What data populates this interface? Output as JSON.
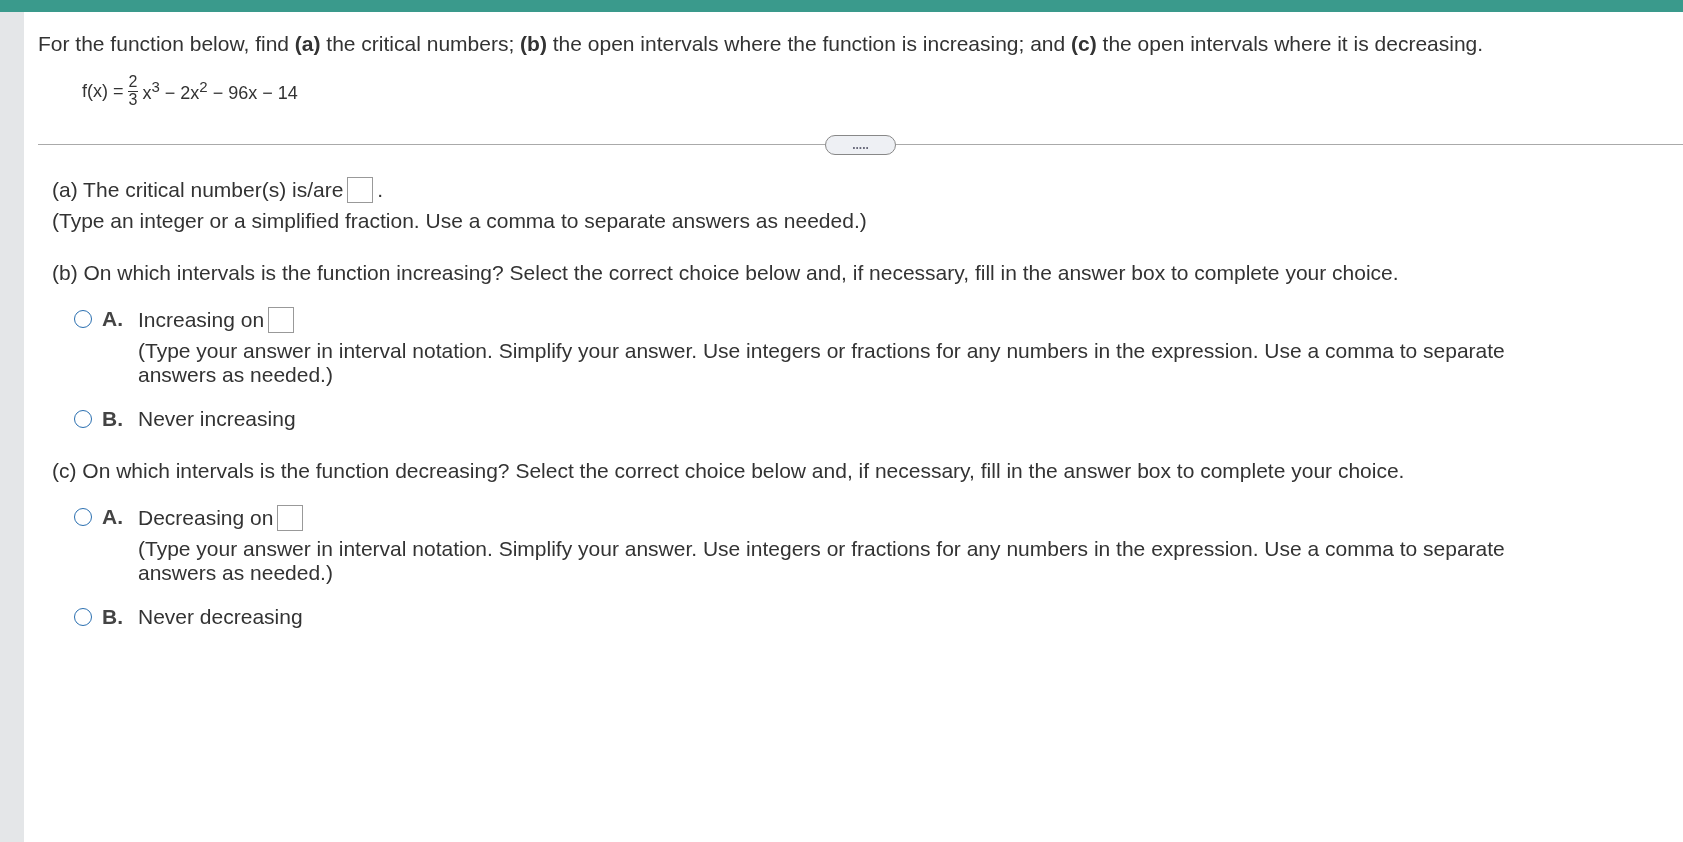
{
  "question": "For the function below, find **(a)** the critical numbers; **(b)** the open intervals where the function is increasing; and **(c)** the open intervals where it is decreasing.",
  "function": {
    "lhs": "f(x) =",
    "numerator": "2",
    "denominator": "3",
    "rest": "x$^{3}$ − 2x$^{2}$ − 96x − 14"
  },
  "expand_button": ".....",
  "part_a": {
    "prompt": "(a) The critical number(s) is/are",
    "after": ".",
    "hint": "(Type an integer or a simplified fraction. Use a comma to separate answers as needed.)"
  },
  "part_b": {
    "prompt": "(b) On which intervals is the function increasing? Select the correct choice below and, if necessary, fill in the answer box to complete your choice.",
    "choices": [
      {
        "kind": "answer",
        "letter": "A.",
        "label": "Increasing on",
        "hint": "(Type your answer in interval notation. Simplify your answer. Use integers or fractions for any numbers in the expression. Use a comma to separate answers as needed.)",
        "selected": false
      },
      {
        "kind": "plain",
        "letter": "B.",
        "label": "Never increasing",
        "selected": false
      }
    ]
  },
  "part_c": {
    "prompt": "(c) On which intervals is the function decreasing? Select the correct choice below and, if necessary, fill in the answer box to complete your choice.",
    "choices": [
      {
        "kind": "answer",
        "letter": "A.",
        "label": "Decreasing on",
        "hint": "(Type your answer in interval notation. Simplify your answer. Use integers or fractions for any numbers in the expression. Use a comma to separate answers as needed.)",
        "selected": false
      },
      {
        "kind": "plain",
        "letter": "B.",
        "label": "Never decreasing",
        "selected": false
      }
    ]
  }
}
